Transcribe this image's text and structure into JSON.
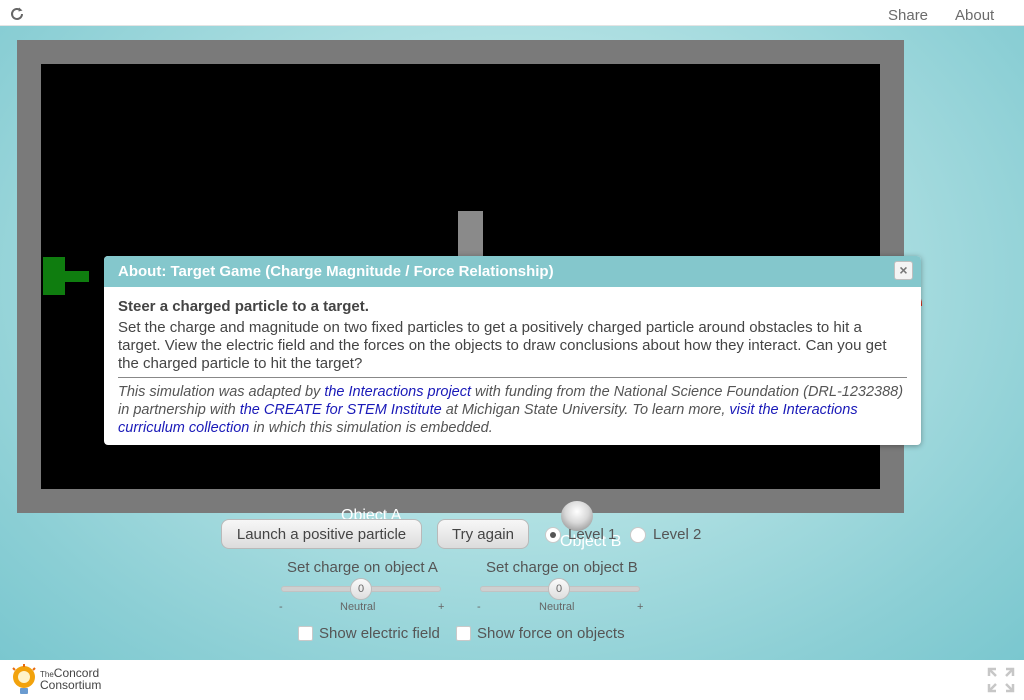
{
  "topbar": {
    "reload_icon": "reload-icon",
    "share_label": "Share",
    "about_label": "About"
  },
  "simulation": {
    "object_a_label": "Object A",
    "object_b_label": "Object B"
  },
  "controls": {
    "launch_label": "Launch a positive particle",
    "try_again_label": "Try again",
    "levels": [
      {
        "label": "Level 1",
        "selected": true
      },
      {
        "label": "Level 2",
        "selected": false
      }
    ],
    "slider_a": {
      "title": "Set charge on object A",
      "value": "0",
      "min_label": "-",
      "max_label": "+",
      "center_label": "Neutral"
    },
    "slider_b": {
      "title": "Set charge on object B",
      "value": "0",
      "min_label": "-",
      "max_label": "+",
      "center_label": "Neutral"
    },
    "show_field_label": "Show electric field",
    "show_force_label": "Show force on objects"
  },
  "dialog": {
    "title": "About: Target Game (Charge Magnitude / Force Relationship)",
    "close_symbol": "×",
    "heading": "Steer a charged particle to a target.",
    "description": "Set the charge and magnitude on two fixed particles to get a positively charged particle around obstacles to hit a target. View the electric field and the forces on the objects to draw conclusions about how they interact. Can you get the charged particle to hit the target?",
    "credits": {
      "part1": "This simulation was adapted by ",
      "link1": "the Interactions project",
      "part2": " with funding from the National Science Foundation (DRL-1232388) in partnership with ",
      "link2": "the CREATE for STEM Institute",
      "part3": " at Michigan State University. To learn more, ",
      "link3": "visit the Interactions curriculum collection",
      "part4": " in which this simulation is embedded."
    }
  },
  "footer": {
    "logo_small": "The",
    "logo_line1": "Concord",
    "logo_line2": "Consortium",
    "fullscreen_icon": "fullscreen-icon"
  },
  "colors": {
    "header_teal": "#84c7cc",
    "launcher_green": "#0f7d0f",
    "target_red": "#d8321e",
    "link_blue": "#1a1ab8"
  }
}
